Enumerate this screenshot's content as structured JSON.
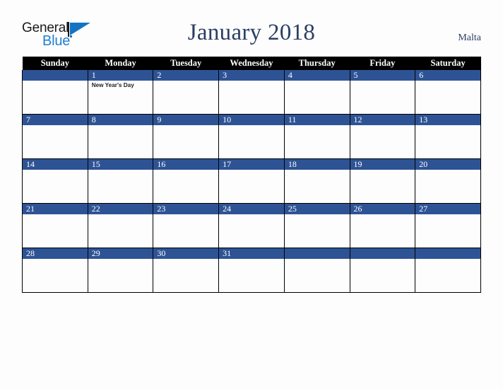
{
  "brand": {
    "word_one": "General",
    "word_two": "Blue",
    "triangle_color": "#1374c4",
    "word_one_color": "#1a1a1a",
    "word_two_color": "#1f7fd0"
  },
  "header": {
    "title": "January 2018",
    "country": "Malta",
    "title_color": "#2b3f63"
  },
  "calendar": {
    "weekday_headers": [
      "Sunday",
      "Monday",
      "Tuesday",
      "Wednesday",
      "Thursday",
      "Friday",
      "Saturday"
    ],
    "header_bg": "#000000",
    "header_text_color": "#ffffff",
    "daynum_bg": "#2e5395",
    "daynum_text_color": "#ffffff",
    "cell_bg": "#fdfdfd",
    "grid_line_color": "#000000",
    "weeks": [
      [
        {
          "day": "",
          "events": []
        },
        {
          "day": "1",
          "events": [
            "New Year's Day"
          ]
        },
        {
          "day": "2",
          "events": []
        },
        {
          "day": "3",
          "events": []
        },
        {
          "day": "4",
          "events": []
        },
        {
          "day": "5",
          "events": []
        },
        {
          "day": "6",
          "events": []
        }
      ],
      [
        {
          "day": "7",
          "events": []
        },
        {
          "day": "8",
          "events": []
        },
        {
          "day": "9",
          "events": []
        },
        {
          "day": "10",
          "events": []
        },
        {
          "day": "11",
          "events": []
        },
        {
          "day": "12",
          "events": []
        },
        {
          "day": "13",
          "events": []
        }
      ],
      [
        {
          "day": "14",
          "events": []
        },
        {
          "day": "15",
          "events": []
        },
        {
          "day": "16",
          "events": []
        },
        {
          "day": "17",
          "events": []
        },
        {
          "day": "18",
          "events": []
        },
        {
          "day": "19",
          "events": []
        },
        {
          "day": "20",
          "events": []
        }
      ],
      [
        {
          "day": "21",
          "events": []
        },
        {
          "day": "22",
          "events": []
        },
        {
          "day": "23",
          "events": []
        },
        {
          "day": "24",
          "events": []
        },
        {
          "day": "25",
          "events": []
        },
        {
          "day": "26",
          "events": []
        },
        {
          "day": "27",
          "events": []
        }
      ],
      [
        {
          "day": "28",
          "events": []
        },
        {
          "day": "29",
          "events": []
        },
        {
          "day": "30",
          "events": []
        },
        {
          "day": "31",
          "events": []
        },
        {
          "day": "",
          "events": []
        },
        {
          "day": "",
          "events": []
        },
        {
          "day": "",
          "events": []
        }
      ]
    ]
  }
}
